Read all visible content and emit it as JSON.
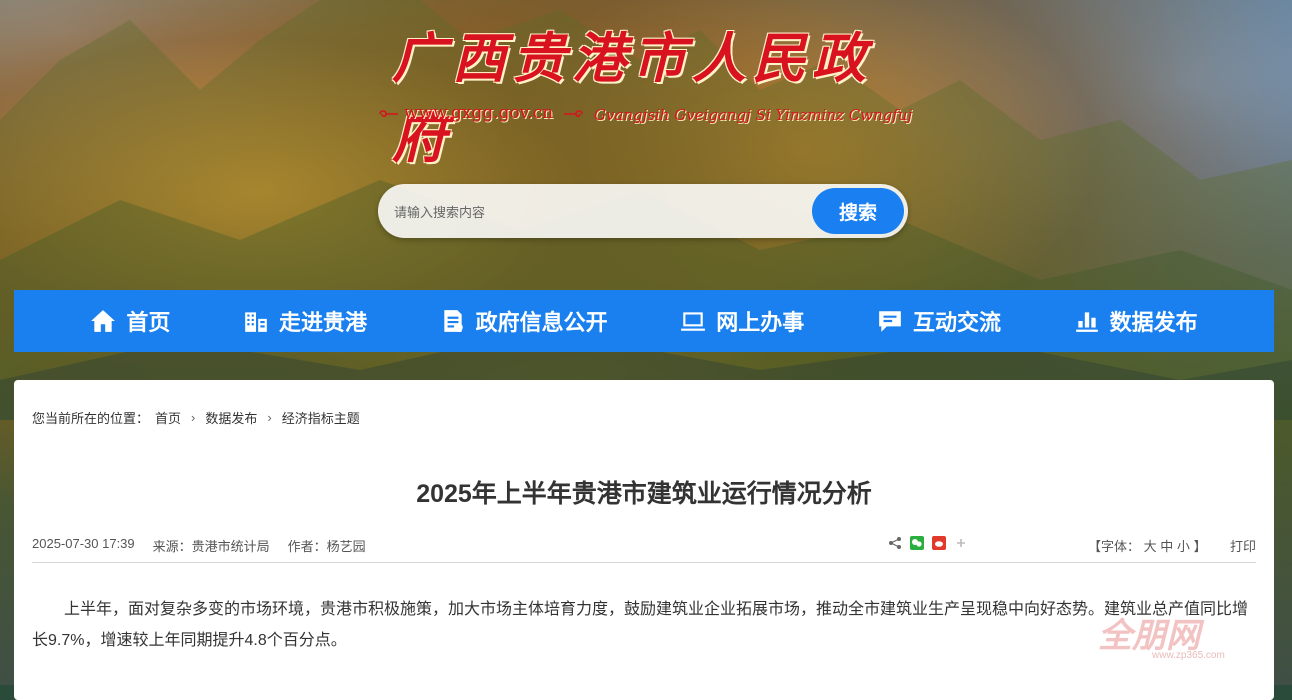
{
  "header": {
    "site_title": "广西贵港市人民政府",
    "site_url": "www.gxgg.gov.cn",
    "site_pinyin": "Gvangjsih Gveigangj Si Yinzminz Cwngfuj"
  },
  "search": {
    "placeholder": "请输入搜索内容",
    "button_label": "搜索"
  },
  "nav": {
    "items": [
      {
        "label": "首页",
        "icon": "home-icon"
      },
      {
        "label": "走进贵港",
        "icon": "city-icon"
      },
      {
        "label": "政府信息公开",
        "icon": "document-icon"
      },
      {
        "label": "网上办事",
        "icon": "laptop-icon"
      },
      {
        "label": "互动交流",
        "icon": "chat-icon"
      },
      {
        "label": "数据发布",
        "icon": "bar-chart-icon"
      }
    ]
  },
  "breadcrumb": {
    "prefix": "您当前所在的位置：",
    "items": [
      "首页",
      "数据发布",
      "经济指标主题"
    ]
  },
  "article": {
    "title": "2025年上半年贵港市建筑业运行情况分析",
    "date": "2025-07-30 17:39",
    "source": "来源：贵港市统计局",
    "author": "作者：杨艺园",
    "font_label_open": "【字体：",
    "font_large": "大",
    "font_medium": "中",
    "font_small": "小",
    "font_label_close": "】",
    "print_label": "打印",
    "body": "上半年，面对复杂多变的市场环境，贵港市积极施策，加大市场主体培育力度，鼓励建筑业企业拓展市场，推动全市建筑业生产呈现稳中向好态势。建筑业总产值同比增长9.7%，增速较上年同期提升4.8个百分点。"
  },
  "watermark": {
    "text": "全朋网",
    "url": "www.zp365.com"
  },
  "colors": {
    "nav_blue": "#1a80f0",
    "title_red": "#d8121e",
    "search_button": "#1a7ff0"
  }
}
